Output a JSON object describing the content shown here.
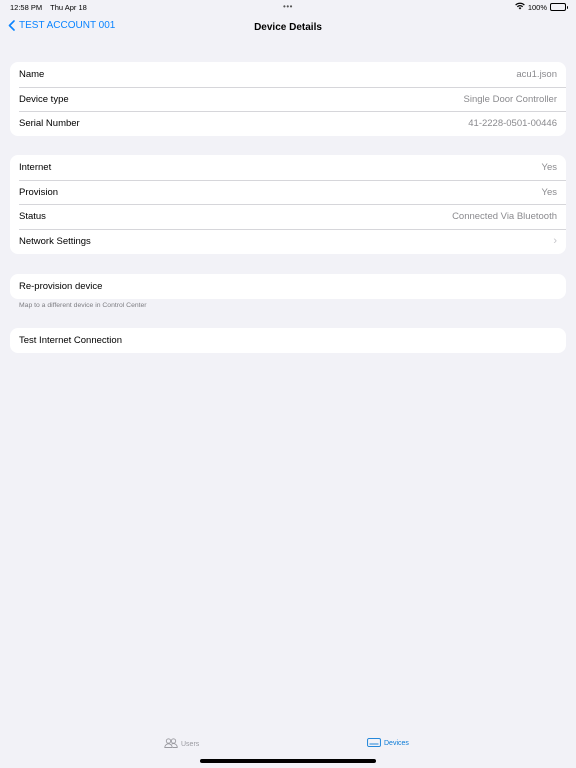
{
  "status_bar": {
    "time": "12:58 PM",
    "date": "Thu Apr 18",
    "dots": "•••",
    "battery": "100%",
    "icons": [
      "wifi-icon",
      "battery-icon"
    ]
  },
  "nav": {
    "back_label": "TEST ACCOUNT 001",
    "title": "Device Details"
  },
  "info": {
    "rows": [
      {
        "label": "Name",
        "value": "acu1.json"
      },
      {
        "label": "Device type",
        "value": "Single Door Controller"
      },
      {
        "label": "Serial Number",
        "value": "41-2228-0501-00446"
      }
    ]
  },
  "connection": {
    "rows": [
      {
        "label": "Internet",
        "value": "Yes"
      },
      {
        "label": "Provision",
        "value": "Yes"
      },
      {
        "label": "Status",
        "value": "Connected Via Bluetooth"
      },
      {
        "label": "Network Settings",
        "value": "›"
      }
    ]
  },
  "reprovision": {
    "label": "Re-provision device",
    "footnote": "Map to a different device in Control Center"
  },
  "test_connection": {
    "label": "Test Internet Connection"
  },
  "tabs": [
    {
      "label": "Users",
      "icon": "users-icon",
      "selected": false
    },
    {
      "label": "Devices",
      "icon": "devices-icon",
      "selected": true
    }
  ],
  "colors": {
    "accent": "#0a7ad6",
    "destructive": "#ff2d20",
    "background": "#f2f2f7"
  }
}
